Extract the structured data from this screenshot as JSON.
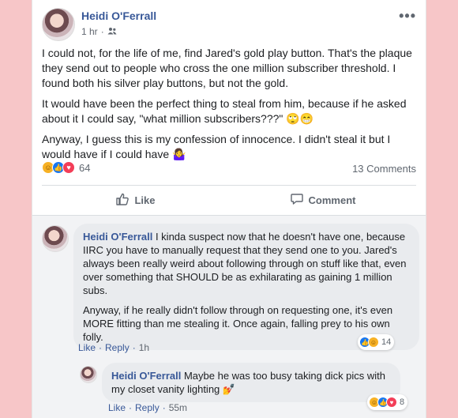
{
  "post": {
    "author": "Heidi O'Ferrall",
    "time": "1 hr",
    "privacy_icon": "friends-icon",
    "more_label": "•••",
    "paragraphs": [
      "I could not, for the life of me, find Jared's gold play button. That's the plaque they send out to people who cross the one million subscriber threshold. I found both his silver play buttons, but not the gold.",
      "It would have been the perfect thing to steal from him, because if he asked about it I could say, \"what million subscribers???\" 🙄😁",
      "Anyway, I guess this is my confession of innocence. I didn't steal it but I would have if I could have 🤷‍♀️"
    ],
    "reaction_count": "64",
    "comment_count": "13 Comments",
    "like_label": "Like",
    "comment_label": "Comment"
  },
  "comments": [
    {
      "author": "Heidi O'Ferrall",
      "text1": " I kinda suspect now that he doesn't have one, because IIRC you have to manually request that they send one to you. Jared's always been really weird about following through on stuff like that, even over something that SHOULD be as exhilarating as gaining 1 million subs.",
      "text2": "Anyway, if he really didn't follow through on requesting one, it's even MORE fitting than me stealing it. Once again, falling prey to his own folly.",
      "like": "Like",
      "reply": "Reply",
      "time": "1h",
      "reactions": "14"
    },
    {
      "author": "Heidi O'Ferrall",
      "text1": " Maybe he was too busy taking dick pics with my closet vanity lighting 💅",
      "like": "Like",
      "reply": "Reply",
      "time": "55m",
      "reactions": "8"
    }
  ],
  "colors": {
    "background": "#f7c6c8",
    "link_blue": "#385898",
    "like_blue": "#1877f2",
    "love_red": "#f33e58",
    "haha_yellow": "#f7b125"
  }
}
